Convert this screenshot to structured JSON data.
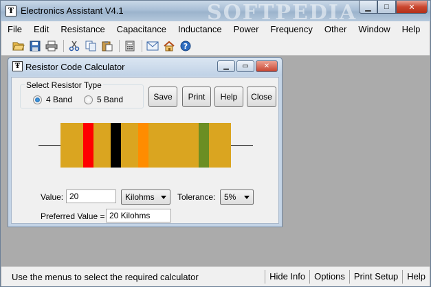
{
  "app": {
    "title": "Electronics Assistant V4.1",
    "watermark": "SOFTPEDIA",
    "window_buttons": {
      "minimize": "▁",
      "maximize": "□",
      "close": "✕"
    }
  },
  "menu": [
    "File",
    "Edit",
    "Resistance",
    "Capacitance",
    "Inductance",
    "Power",
    "Frequency",
    "Other",
    "Window",
    "Help"
  ],
  "toolbar": {
    "icons": [
      "open-folder-icon",
      "save-icon",
      "print-icon",
      "cut-icon",
      "copy-icon",
      "paste-icon",
      "calculator-icon",
      "email-icon",
      "home-icon",
      "help-icon"
    ]
  },
  "status": {
    "text": "Use the menus to select the required calculator",
    "buttons": [
      "Hide Info",
      "Options",
      "Print Setup",
      "Help"
    ]
  },
  "dialog": {
    "title": "Resistor Code Calculator",
    "buttons": {
      "minimize": "▁",
      "maximize": "▭",
      "close": "✕"
    },
    "group_label": "Select Resistor Type",
    "radio_4band": "4 Band",
    "radio_5band": "5 Band",
    "selected_type": "4 Band",
    "actions": {
      "save": "Save",
      "print": "Print",
      "help": "Help",
      "close": "Close"
    },
    "resistor": {
      "body_color": "#daa520",
      "bands": [
        {
          "color": "#ff0000",
          "name": "red"
        },
        {
          "color": "#000000",
          "name": "black"
        },
        {
          "color": "#ff8c00",
          "name": "orange"
        },
        {
          "color": "#6b8e23",
          "name": "olive"
        }
      ]
    },
    "value_label": "Value:",
    "value": "20",
    "unit": "Kilohms",
    "tolerance_label": "Tolerance:",
    "tolerance": "5%",
    "preferred_label": "Preferred Value =",
    "preferred_value": "20 Kilohms"
  }
}
